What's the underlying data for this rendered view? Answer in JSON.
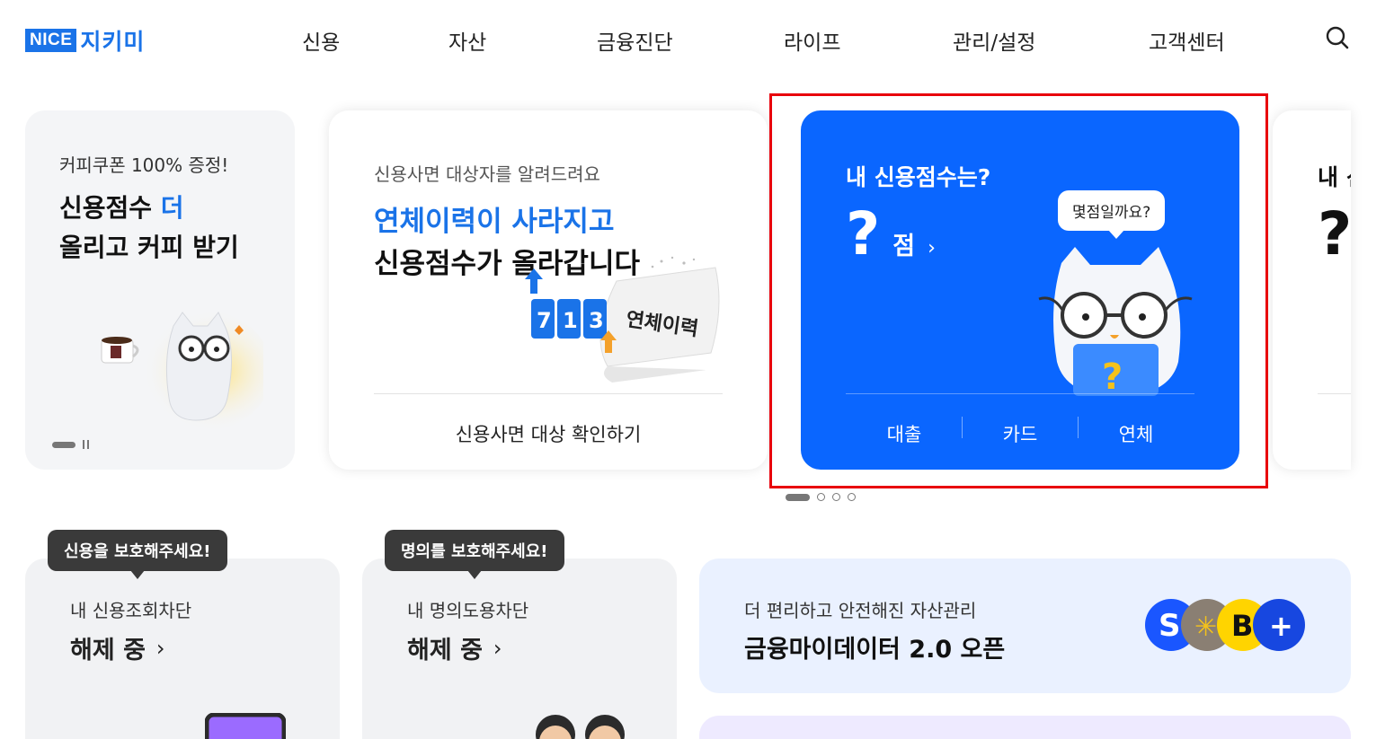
{
  "header": {
    "logo_badge": "NICE",
    "logo_text": "지키미",
    "nav": [
      "신용",
      "자산",
      "금융진단",
      "라이프",
      "관리/설정",
      "고객센터"
    ]
  },
  "banner_cards": {
    "coffee": {
      "subtitle": "커피쿠폰 100% 증정!",
      "title_part1": "신용점수 ",
      "title_highlight": "더",
      "title_line2": "올리고 커피 받기"
    },
    "amnesty": {
      "subtitle": "신용사면 대상자를 알려드려요",
      "title_line1": "연체이력이 사라지고",
      "title_line2": "신용점수가 올라갑니다",
      "illus_digits": [
        "7",
        "1",
        "3"
      ],
      "illus_paper_label": "연체이력",
      "link": "신용사면 대상 확인하기"
    },
    "score": {
      "title": "내 신용점수는?",
      "score_value": "?",
      "score_unit": "점",
      "score_chevron": "›",
      "bubble": "몇점일까요?",
      "illus_badge": "?",
      "tabs": [
        "대출",
        "카드",
        "연체"
      ]
    },
    "next_partial": {
      "title": "내 신",
      "score_value": "?"
    }
  },
  "lower_cards": {
    "credit_lock": {
      "tooltip": "신용을 보호해주세요!",
      "subtitle": "내 신용조회차단",
      "status": "해제 중",
      "chevron": "›"
    },
    "identity_lock": {
      "tooltip": "명의를 보호해주세요!",
      "subtitle": "내 명의도용차단",
      "status": "해제 중",
      "chevron": "›"
    },
    "mydata": {
      "subtitle": "더 편리하고 안전해진 자산관리",
      "title": "금융마이데이터 2.0 오픈",
      "bank_badges": [
        "S",
        "B",
        "+"
      ]
    }
  },
  "colors": {
    "brand_blue": "#1a73e8",
    "score_card_bg": "#0a66ff",
    "highlight_border": "#e8000b",
    "tooltip_bg": "#3a3a3a"
  },
  "icons": {
    "search": "search-icon",
    "pause": "pause-icon"
  }
}
